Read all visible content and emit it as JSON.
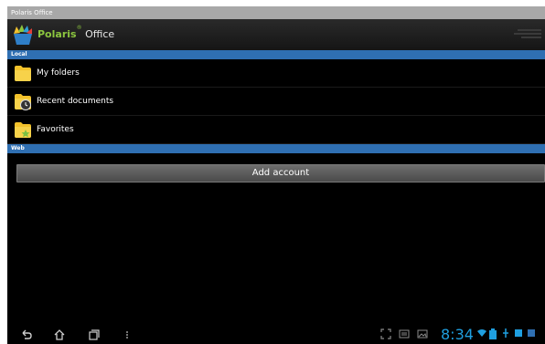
{
  "window": {
    "title": "Polaris Office"
  },
  "app_bar": {
    "brand_name": "Polaris",
    "brand_suffix": "Office",
    "brand_mark": "®"
  },
  "sections": {
    "local": "Local",
    "web": "Web"
  },
  "local_items": [
    {
      "label": "My folders",
      "icon": "folder-icon"
    },
    {
      "label": "Recent documents",
      "icon": "recent-documents-icon"
    },
    {
      "label": "Favorites",
      "icon": "favorites-folder-icon"
    }
  ],
  "web": {
    "add_account_label": "Add account"
  },
  "status_bar": {
    "time": "8:34"
  },
  "colors": {
    "section_header": "#2f6fb2",
    "brand_green": "#8cc63f",
    "clock_blue": "#1f9fe0",
    "folder_yellow": "#f3c22b"
  }
}
